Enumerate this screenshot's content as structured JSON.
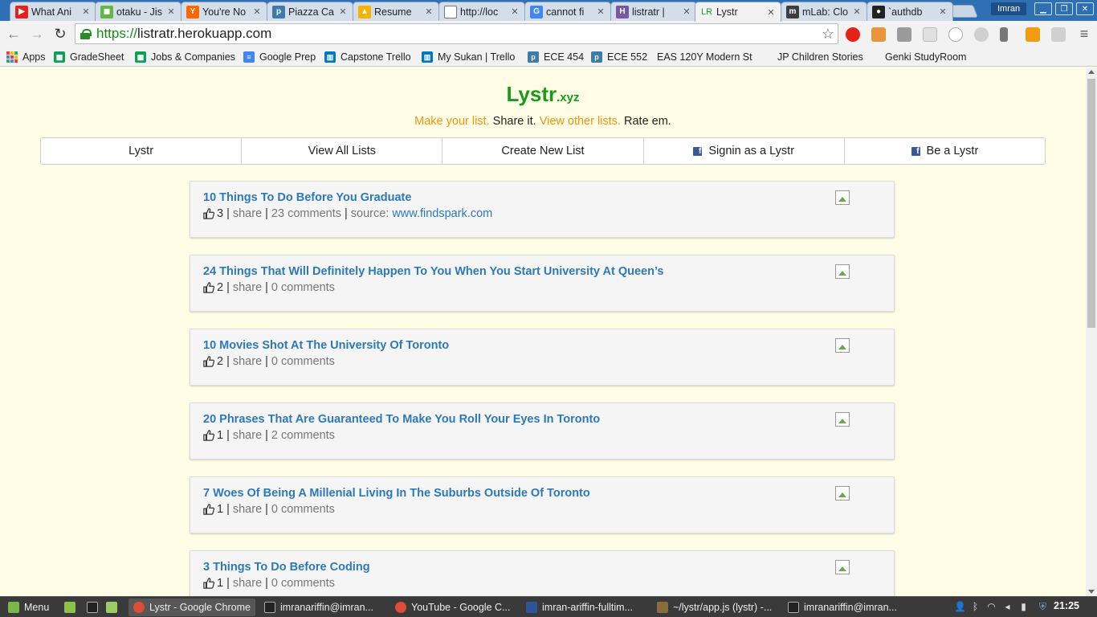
{
  "browser": {
    "tabs": [
      {
        "label": "What Ani",
        "icon": "youtube-icon",
        "color": "#e62117",
        "glyph": "▶"
      },
      {
        "label": "otaku - Jis",
        "icon": "chat-icon",
        "color": "#60b845",
        "glyph": "◼"
      },
      {
        "label": "You're No",
        "icon": "ycombinator-icon",
        "color": "#ff6600",
        "glyph": "Y"
      },
      {
        "label": "Piazza Ca",
        "icon": "piazza-icon",
        "color": "#3e7aab",
        "glyph": "p"
      },
      {
        "label": "Resume",
        "icon": "google-drive-icon",
        "color": "#f4b400",
        "glyph": "▲"
      },
      {
        "label": "http://loc",
        "icon": "page-icon",
        "color": "#ffffff",
        "glyph": ""
      },
      {
        "label": "cannot fi",
        "icon": "google-icon",
        "color": "#4285f4",
        "glyph": "G"
      },
      {
        "label": "listratr |",
        "icon": "heroku-icon",
        "color": "#79589f",
        "glyph": "H"
      },
      {
        "label": "Lystr",
        "icon": "lystr-icon",
        "color": "#1a9a1a",
        "glyph": "LR",
        "active": true
      },
      {
        "label": "mLab: Clo",
        "icon": "mlab-icon",
        "color": "#3d3d3d",
        "glyph": "m"
      },
      {
        "label": "`authdb",
        "icon": "github-icon",
        "color": "#222222",
        "glyph": "●"
      }
    ],
    "user_name": "Imran",
    "url_scheme": "https://",
    "url_host": "listratr.herokuapp.com",
    "bookmarks": [
      {
        "label": "Apps",
        "type": "apps"
      },
      {
        "label": "GradeSheet",
        "type": "sheet"
      },
      {
        "label": "Jobs & Companies",
        "type": "sheet"
      },
      {
        "label": "Google Prep",
        "type": "doc"
      },
      {
        "label": "Capstone Trello",
        "type": "trello"
      },
      {
        "label": "My Sukan | Trello",
        "type": "trello"
      },
      {
        "label": "ECE 454",
        "type": "piazza"
      },
      {
        "label": "ECE 552",
        "type": "piazza"
      },
      {
        "label": "EAS 120Y Modern St",
        "type": "page"
      },
      {
        "label": "JP Children Stories",
        "type": "page"
      },
      {
        "label": "Genki StudyRoom",
        "type": "page"
      }
    ]
  },
  "site": {
    "brand": "Lystr",
    "brand_suffix": ".xyz",
    "tagline": {
      "part1": "Make your list.",
      "part2": "Share it.",
      "part3": "View other lists.",
      "part4": "Rate em."
    },
    "nav": [
      {
        "label": "Lystr",
        "facebook": false
      },
      {
        "label": "View All Lists",
        "facebook": false
      },
      {
        "label": "Create New List",
        "facebook": false
      },
      {
        "label": "Signin as a Lystr",
        "facebook": true
      },
      {
        "label": "Be a Lystr",
        "facebook": true
      }
    ],
    "share_label": "share",
    "comments_suffix": "comments",
    "source_prefix": "source:",
    "lists": [
      {
        "title": "10 Things To Do Before You Graduate",
        "likes": "3",
        "comments": "23",
        "source": "www.findspark.com"
      },
      {
        "title": "24 Things That Will Definitely Happen To You When You Start University At Queen’s",
        "likes": "2",
        "comments": "0"
      },
      {
        "title": "10 Movies Shot At The University Of Toronto",
        "likes": "2",
        "comments": "0"
      },
      {
        "title": "20 Phrases That Are Guaranteed To Make You Roll Your Eyes In Toronto",
        "likes": "1",
        "comments": "2"
      },
      {
        "title": "7 Woes Of Being A Millenial Living In The Suburbs Outside Of Toronto",
        "likes": "1",
        "comments": "0"
      },
      {
        "title": "3 Things To Do Before Coding",
        "likes": "1",
        "comments": "0"
      }
    ]
  },
  "taskbar": {
    "menu_label": "Menu",
    "windows": [
      {
        "label": "Lystr - Google Chrome",
        "icon": "chrome-icon",
        "active": true
      },
      {
        "label": "imranariffin@imran...",
        "icon": "terminal-icon"
      },
      {
        "label": "YouTube - Google C...",
        "icon": "chrome-icon"
      },
      {
        "label": "imran-ariffin-fulltim...",
        "icon": "document-icon"
      },
      {
        "label": "~/lystr/app.js (lystr) -...",
        "icon": "editor-icon"
      },
      {
        "label": "imranariffin@imran...",
        "icon": "terminal-icon"
      }
    ],
    "clock": "21:25"
  }
}
